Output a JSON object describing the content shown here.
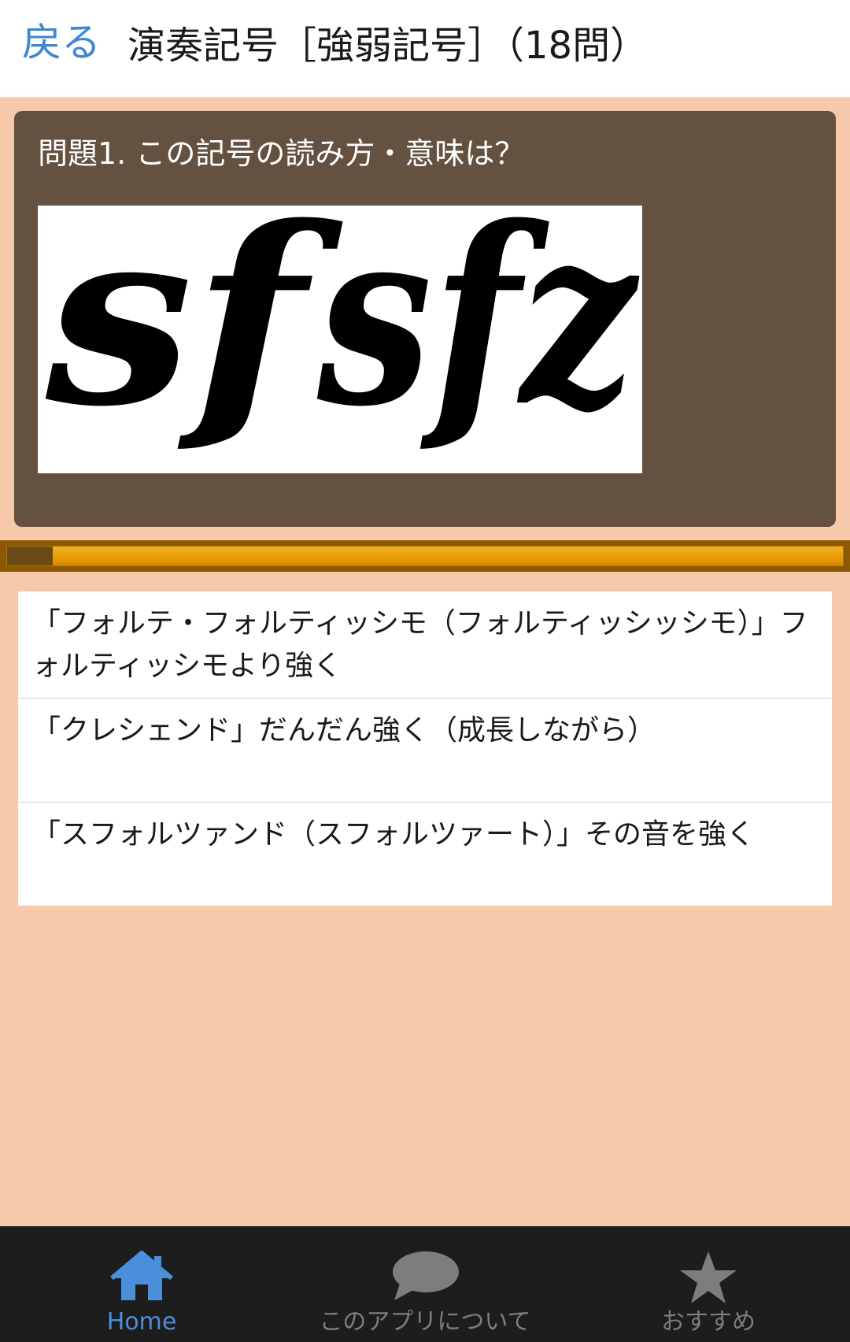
{
  "header": {
    "back_label": "戻る",
    "title": "演奏記号［強弱記号］（18問）"
  },
  "question": {
    "text": "問題1. この記号の読み方・意味は？",
    "image_symbols": [
      "sf",
      "sfz"
    ]
  },
  "progress": {
    "fraction": 0.055
  },
  "answers": [
    {
      "label": "「フォルテ・フォルティッシモ（フォルティッシッシモ）」フォルティッシモより強く"
    },
    {
      "label": "「クレシェンド」だんだん強く（成長しながら）"
    },
    {
      "label": "「スフォルツァンド（スフォルツァート）」その音を強く"
    }
  ],
  "tabs": [
    {
      "label": "Home",
      "icon": "home-icon",
      "active": true
    },
    {
      "label": "このアプリについて",
      "icon": "speech-bubble-icon",
      "active": false
    },
    {
      "label": "おすすめ",
      "icon": "star-icon",
      "active": false
    }
  ],
  "colors": {
    "accent": "#3d86d6",
    "card": "#645140",
    "background": "#f6c9ab",
    "progress": "#e89b05",
    "tabbar": "#1d1d1d"
  }
}
